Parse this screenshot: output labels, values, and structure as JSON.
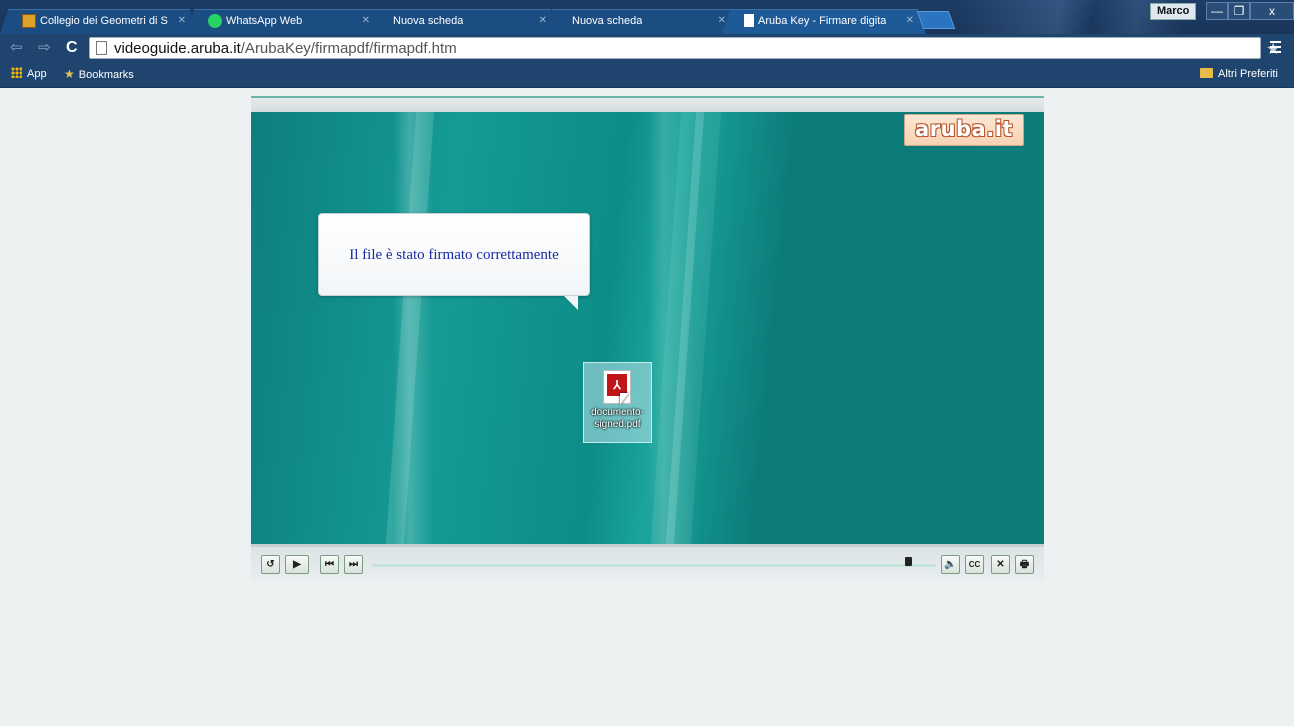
{
  "browser": {
    "tabs": [
      {
        "label": "Collegio dei Geometri di S",
        "icon": "collegio-favicon"
      },
      {
        "label": "WhatsApp Web",
        "icon": "whatsapp-icon"
      },
      {
        "label": "Nuova scheda",
        "icon": ""
      },
      {
        "label": "Nuova scheda",
        "icon": ""
      },
      {
        "label": "Aruba Key - Firmare digita",
        "icon": "page-icon",
        "active": true
      }
    ],
    "profile_name": "Marco",
    "window_buttons": {
      "minimize": "—",
      "restore": "❐",
      "close": "x"
    },
    "url_host": "videoguide.aruba.it",
    "url_path": "/ArubaKey/firmapdf/firmapdf.htm",
    "bookmarks_bar": {
      "apps_label": "App",
      "bookmarks_label": "Bookmarks",
      "other_label": "Altri Preferiti"
    }
  },
  "video": {
    "logo_text": "aruba.it",
    "callout_text": "Il file è stato firmato correttamente",
    "file_label_line1": "documento-",
    "file_label_line2": "signed.pdf",
    "progress": 0.95
  },
  "controls": {
    "rewind": "↺",
    "play": "▶",
    "prev": "⏮",
    "next": "⏭",
    "volume": "🔈",
    "cc": "CC",
    "close": "✕",
    "print": "🖶"
  },
  "colors": {
    "chrome_dark": "#1f456f",
    "video_teal": "#0e8c88",
    "callout_text": "#1a2aa3",
    "aruba_orange": "#b6532b"
  }
}
